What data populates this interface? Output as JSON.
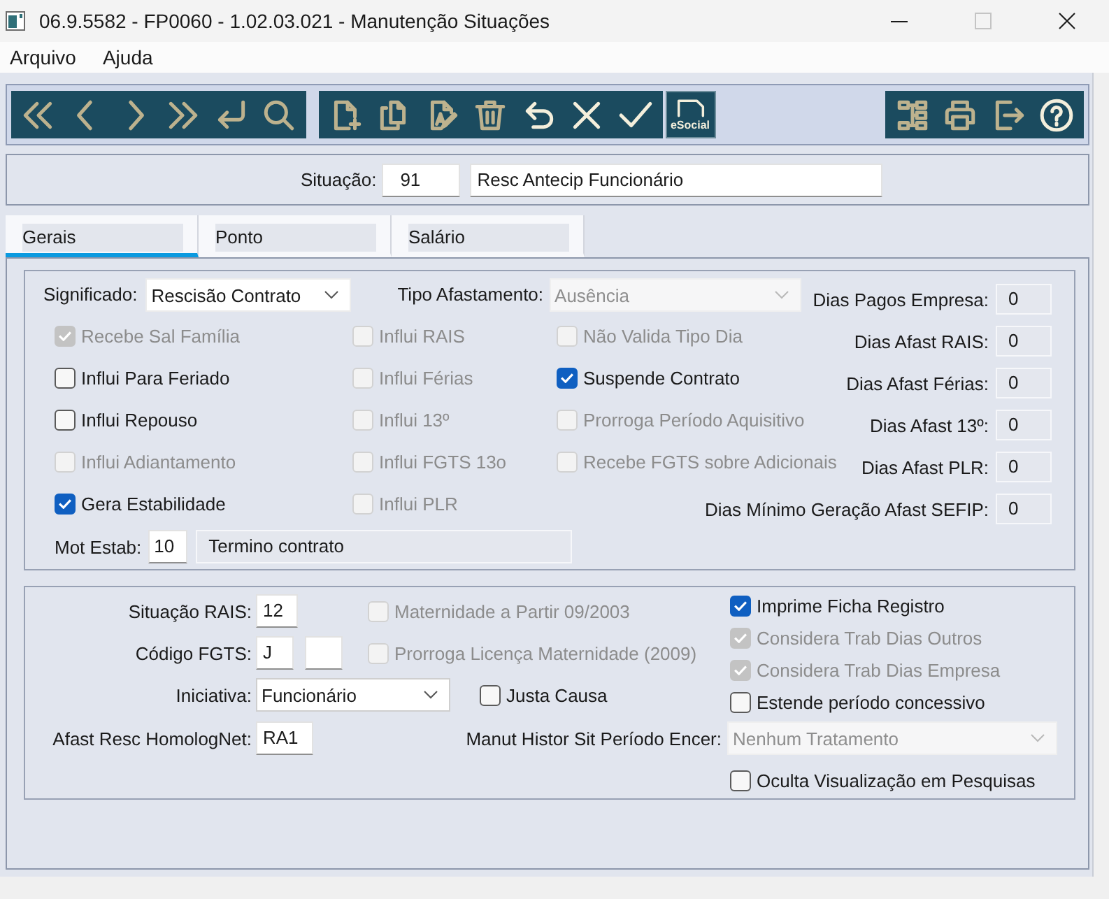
{
  "window": {
    "title": "06.9.5582 - FP0060 - 1.02.03.021 - Manutenção Situações",
    "controls": [
      {
        "kind": "minimize",
        "disabled": false
      },
      {
        "kind": "maximize",
        "disabled": true
      },
      {
        "kind": "close",
        "disabled": false
      }
    ]
  },
  "menu": [
    "Arquivo",
    "Ajuda"
  ],
  "toolbar": {
    "groups": [
      {
        "buttons": [
          {
            "kind": "first",
            "enabled": false
          },
          {
            "kind": "prev",
            "enabled": false
          },
          {
            "kind": "next",
            "enabled": false
          },
          {
            "kind": "last",
            "enabled": false
          },
          {
            "kind": "enter",
            "enabled": false
          },
          {
            "kind": "search",
            "enabled": false
          }
        ]
      },
      {
        "buttons": [
          {
            "kind": "new",
            "enabled": false
          },
          {
            "kind": "copy",
            "enabled": false
          },
          {
            "kind": "edit",
            "enabled": false
          },
          {
            "kind": "delete",
            "enabled": false
          },
          {
            "kind": "undo",
            "enabled": true
          },
          {
            "kind": "cancel",
            "enabled": true
          },
          {
            "kind": "confirm",
            "enabled": true
          }
        ]
      },
      {
        "buttons": [
          {
            "kind": "esocial",
            "label": "eSocial",
            "enabled": true
          }
        ]
      },
      {
        "buttons": [
          {
            "kind": "tree",
            "enabled": false
          },
          {
            "kind": "print",
            "enabled": false
          },
          {
            "kind": "exit",
            "enabled": false
          },
          {
            "kind": "help",
            "enabled": true
          }
        ]
      }
    ]
  },
  "situacao": {
    "label": "Situação:",
    "code": "91",
    "description": "Resc Antecip Funcionário"
  },
  "tabs": [
    {
      "label": "Gerais",
      "selected": true
    },
    {
      "label": "Ponto",
      "selected": false
    },
    {
      "label": "Salário",
      "selected": false
    }
  ],
  "upper_group": {
    "significado": {
      "label": "Significado:",
      "value": "Rescisão Contrato",
      "disabled": false
    },
    "tipo_afastamento": {
      "label": "Tipo Afastamento:",
      "value": "Ausência",
      "disabled": true
    },
    "checkbox_columns": [
      [
        {
          "label": "Recebe Sal Família",
          "checked": true,
          "disabled": true
        },
        {
          "label": "Influi Para Feriado",
          "checked": false,
          "disabled": false
        },
        {
          "label": "Influi Repouso",
          "checked": false,
          "disabled": false
        },
        {
          "label": "Influi Adiantamento",
          "checked": false,
          "disabled": true
        },
        {
          "label": "Gera Estabilidade",
          "checked": true,
          "disabled": false
        }
      ],
      [
        {
          "label": "Influi RAIS",
          "checked": false,
          "disabled": true
        },
        {
          "label": "Influi Férias",
          "checked": false,
          "disabled": true
        },
        {
          "label": "Influi 13º",
          "checked": false,
          "disabled": true
        },
        {
          "label": "Influi FGTS 13o",
          "checked": false,
          "disabled": true
        },
        {
          "label": "Influi PLR",
          "checked": false,
          "disabled": true
        }
      ],
      [
        {
          "label": "Não Valida Tipo Dia",
          "checked": false,
          "disabled": true
        },
        {
          "label": "Suspende Contrato",
          "checked": true,
          "disabled": false
        },
        {
          "label": "Prorroga Período Aquisitivo",
          "checked": false,
          "disabled": true
        },
        {
          "label": "Recebe FGTS sobre Adicionais",
          "checked": false,
          "disabled": true
        }
      ]
    ],
    "dias": [
      {
        "label": "Dias Pagos Empresa:",
        "value": "0"
      },
      {
        "label": "Dias Afast RAIS:",
        "value": "0"
      },
      {
        "label": "Dias Afast Férias:",
        "value": "0"
      },
      {
        "label": "Dias Afast 13º:",
        "value": "0"
      },
      {
        "label": "Dias Afast PLR:",
        "value": "0"
      },
      {
        "label": "Dias Mínimo Geração Afast SEFIP:",
        "value": "0"
      }
    ],
    "mot_estab": {
      "label": "Mot Estab:",
      "code": "10",
      "description": "Termino contrato"
    }
  },
  "lower_group": {
    "fields": [
      {
        "kind": "text",
        "label": "Situação RAIS:",
        "value": "12"
      },
      {
        "kind": "pair",
        "label": "Código FGTS:",
        "value": "J"
      },
      {
        "kind": "select",
        "label": "Iniciativa:",
        "value": "Funcionário",
        "disabled": false
      },
      {
        "kind": "text",
        "label": "Afast Resc HomologNet:",
        "value": "RA1"
      }
    ],
    "middle_checkboxes": [
      {
        "label": "Maternidade a Partir 09/2003",
        "checked": false,
        "disabled": true
      },
      {
        "label": "Prorroga Licença Maternidade (2009)",
        "checked": false,
        "disabled": true
      },
      {
        "label": "Justa Causa",
        "checked": false,
        "disabled": false
      }
    ],
    "right_checkboxes": [
      {
        "label": "Imprime Ficha Registro",
        "checked": true,
        "disabled": false
      },
      {
        "label": "Considera Trab Dias Outros",
        "checked": true,
        "disabled": true
      },
      {
        "label": "Considera Trab Dias Empresa",
        "checked": true,
        "disabled": true
      },
      {
        "label": "Estende período concessivo",
        "checked": false,
        "disabled": false
      }
    ],
    "manut_histor": {
      "label": "Manut Histor Sit Período Encer:",
      "value": "Nenhum Tratamento",
      "disabled": true
    },
    "oculta": {
      "label": "Oculta Visualização em Pesquisas",
      "checked": false,
      "disabled": false
    }
  }
}
